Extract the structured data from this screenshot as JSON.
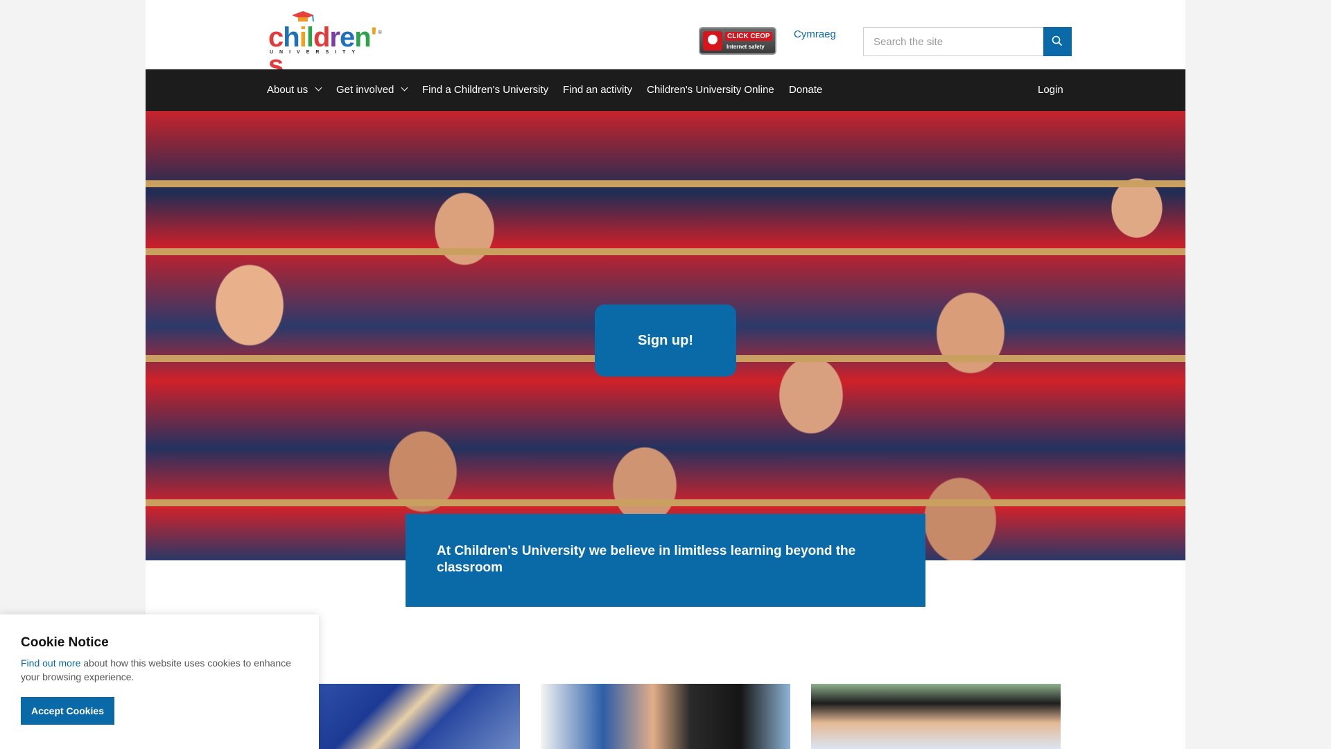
{
  "header": {
    "logo_text": "children's",
    "logo_subtext": "UNIVERSITY",
    "ceop_badge": {
      "title": "CLICK CEOP",
      "subtitle": "Internet safety"
    },
    "language_link": "Cymraeg",
    "search": {
      "placeholder": "Search the site",
      "value": ""
    }
  },
  "nav": {
    "items": [
      {
        "label": "About us",
        "has_dropdown": true
      },
      {
        "label": "Get involved",
        "has_dropdown": true
      },
      {
        "label": "Find a Children's University",
        "has_dropdown": false
      },
      {
        "label": "Find an activity",
        "has_dropdown": false
      },
      {
        "label": "Children's University Online",
        "has_dropdown": false
      },
      {
        "label": "Donate",
        "has_dropdown": false
      }
    ],
    "login": "Login"
  },
  "hero": {
    "signup_label": "Sign up!",
    "tagline": "At Children's University we believe in limitless learning beyond the classroom"
  },
  "cookie_notice": {
    "title": "Cookie Notice",
    "link_text": "Find out more",
    "body": " about how this website uses cookies to enhance your browsing experience.",
    "accept_label": "Accept Cookies"
  },
  "colors": {
    "brand_blue": "#0a6aa8",
    "nav_bg": "#1c1c1c"
  }
}
